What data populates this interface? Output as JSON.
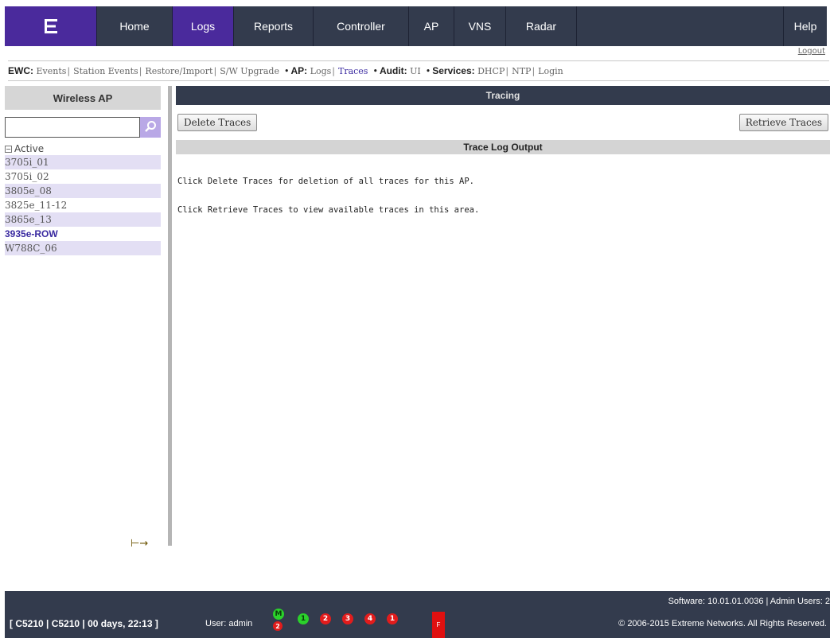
{
  "nav": {
    "tabs": [
      "Home",
      "Logs",
      "Reports",
      "Controller",
      "AP",
      "VNS",
      "Radar",
      "Help"
    ],
    "active": "Logs"
  },
  "logout": "Logout",
  "subnav": {
    "ewc_label": "EWC:",
    "ewc_links": [
      "Events",
      "Station Events",
      "Restore/Import",
      "S/W Upgrade"
    ],
    "ap_label": "AP:",
    "ap_links": [
      "Logs",
      "Traces"
    ],
    "audit_label": "Audit:",
    "audit_links": [
      "UI"
    ],
    "services_label": "Services:",
    "services_links": [
      "DHCP",
      "NTP",
      "Login"
    ],
    "selected": "Traces"
  },
  "sidebar": {
    "title": "Wireless AP",
    "search_value": "",
    "tree_root": "Active",
    "items": [
      "3705i_01",
      "3705i_02",
      "3805e_08",
      "3825e_11-12",
      "3865e_13",
      "3935e-ROW",
      "W788C_06"
    ],
    "selected": "3935e-ROW"
  },
  "main": {
    "title": "Tracing",
    "delete_button": "Delete Traces",
    "retrieve_button": "Retrieve Traces",
    "output_title": "Trace Log Output",
    "output_lines": [
      "Click Delete Traces for deletion of all traces for this AP.",
      "Click Retrieve Traces to view available traces in this area."
    ]
  },
  "footer": {
    "status": "[ C5210 | C5210 | 00 days, 22:13 ]",
    "user": "User: admin",
    "software": "Software: 10.01.01.0036 | Admin Users: 2",
    "copyright": "© 2006-2015  Extreme Networks. All Rights Reserved.",
    "indicators": [
      "M",
      "2",
      "1",
      "2",
      "3",
      "4",
      "1"
    ],
    "flag": "F",
    "colors": {
      "green": "#2bd12b",
      "red": "#e21c1c"
    }
  },
  "theme": {
    "brand": "#4a2a9c",
    "nav_bg": "#333b4d"
  }
}
